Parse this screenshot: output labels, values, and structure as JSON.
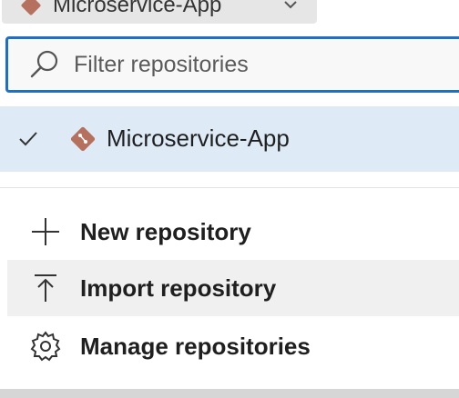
{
  "selector": {
    "label": "Microservice-App"
  },
  "search": {
    "placeholder": "Filter repositories",
    "value": ""
  },
  "repositories": [
    {
      "name": "Microservice-App",
      "selected": true
    }
  ],
  "actions": {
    "new_label": "New repository",
    "import_label": "Import repository",
    "manage_label": "Manage repositories"
  },
  "colors": {
    "accent": "#1f6fc5",
    "selected_row": "#deebf7",
    "git_icon": "#b5705e"
  }
}
